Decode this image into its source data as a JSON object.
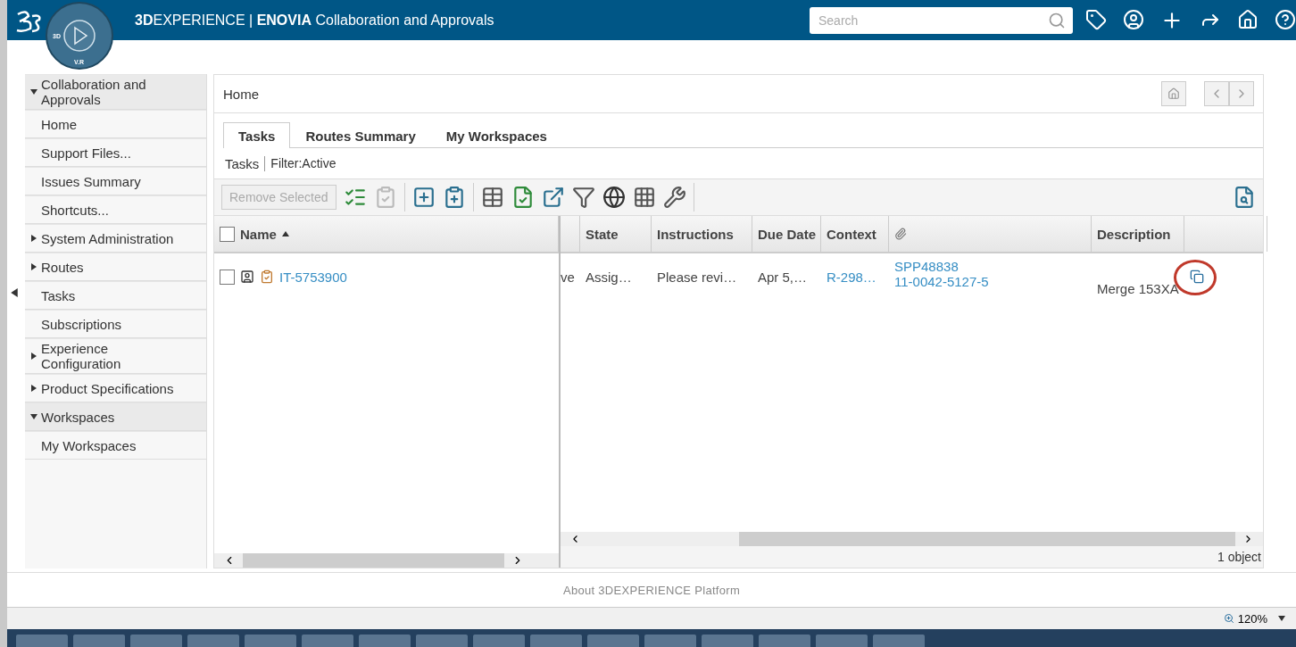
{
  "header": {
    "title": "**3D**EXPERIENCE | **ENOVIA** Collaboration and Approvals",
    "compass_labels": [
      "3D",
      "V.R"
    ],
    "search": {
      "placeholder": "Search"
    }
  },
  "sidebar": {
    "items": [
      {
        "kind": "section",
        "label": "Collaboration and Approvals",
        "expanded": true,
        "children": [
          {
            "label": "Home"
          },
          {
            "label": "Support Files..."
          },
          {
            "label": "Issues Summary"
          },
          {
            "label": "Shortcuts..."
          }
        ]
      },
      {
        "kind": "section",
        "label": "System Administration",
        "expanded": false
      },
      {
        "kind": "section",
        "label": "Routes",
        "expanded": false
      },
      {
        "kind": "link",
        "label": "Tasks"
      },
      {
        "kind": "link",
        "label": "Subscriptions"
      },
      {
        "kind": "section",
        "label": "Experience Configuration",
        "expanded": false
      },
      {
        "kind": "section",
        "label": "Product Specifications",
        "expanded": false
      },
      {
        "kind": "section",
        "label": "Workspaces",
        "expanded": true,
        "children": [
          {
            "label": "My Workspaces"
          }
        ]
      }
    ]
  },
  "page": {
    "breadcrumb": "Home",
    "tabs": [
      {
        "label": "Tasks",
        "selected": true
      },
      {
        "label": "Routes Summary",
        "selected": false
      },
      {
        "label": "My Workspaces",
        "selected": false
      }
    ],
    "filter": {
      "title": "Tasks",
      "value": "Filter:Active"
    },
    "toolbar": {
      "remove_button": {
        "label": "Remove Selected",
        "disabled": true
      }
    },
    "table": {
      "all_checked": false,
      "frozen_columns": [
        {
          "label": "Name",
          "sorted": true
        }
      ],
      "columns": [
        {
          "kind": "blank"
        },
        {
          "label": "State"
        },
        {
          "label": "Instructions"
        },
        {
          "label": "Due Date"
        },
        {
          "label": "Context"
        },
        {
          "kind": "attachment"
        },
        {
          "label": "Description"
        },
        {
          "kind": "blank"
        }
      ],
      "rows": [
        {
          "checked": false,
          "name": "IT-5753900",
          "cells": [
            "ve",
            "Assig…",
            "Please revi…",
            "Apr 5,…"
          ],
          "context": "R-298…",
          "attachments": [
            "SPP48838",
            "11-0042-5127-5"
          ],
          "description": "Merge 153XA"
        }
      ]
    },
    "count": "1 object"
  },
  "footer": {
    "about": "About 3DEXPERIENCE Platform"
  },
  "status_bar": {
    "zoom": "120%"
  }
}
